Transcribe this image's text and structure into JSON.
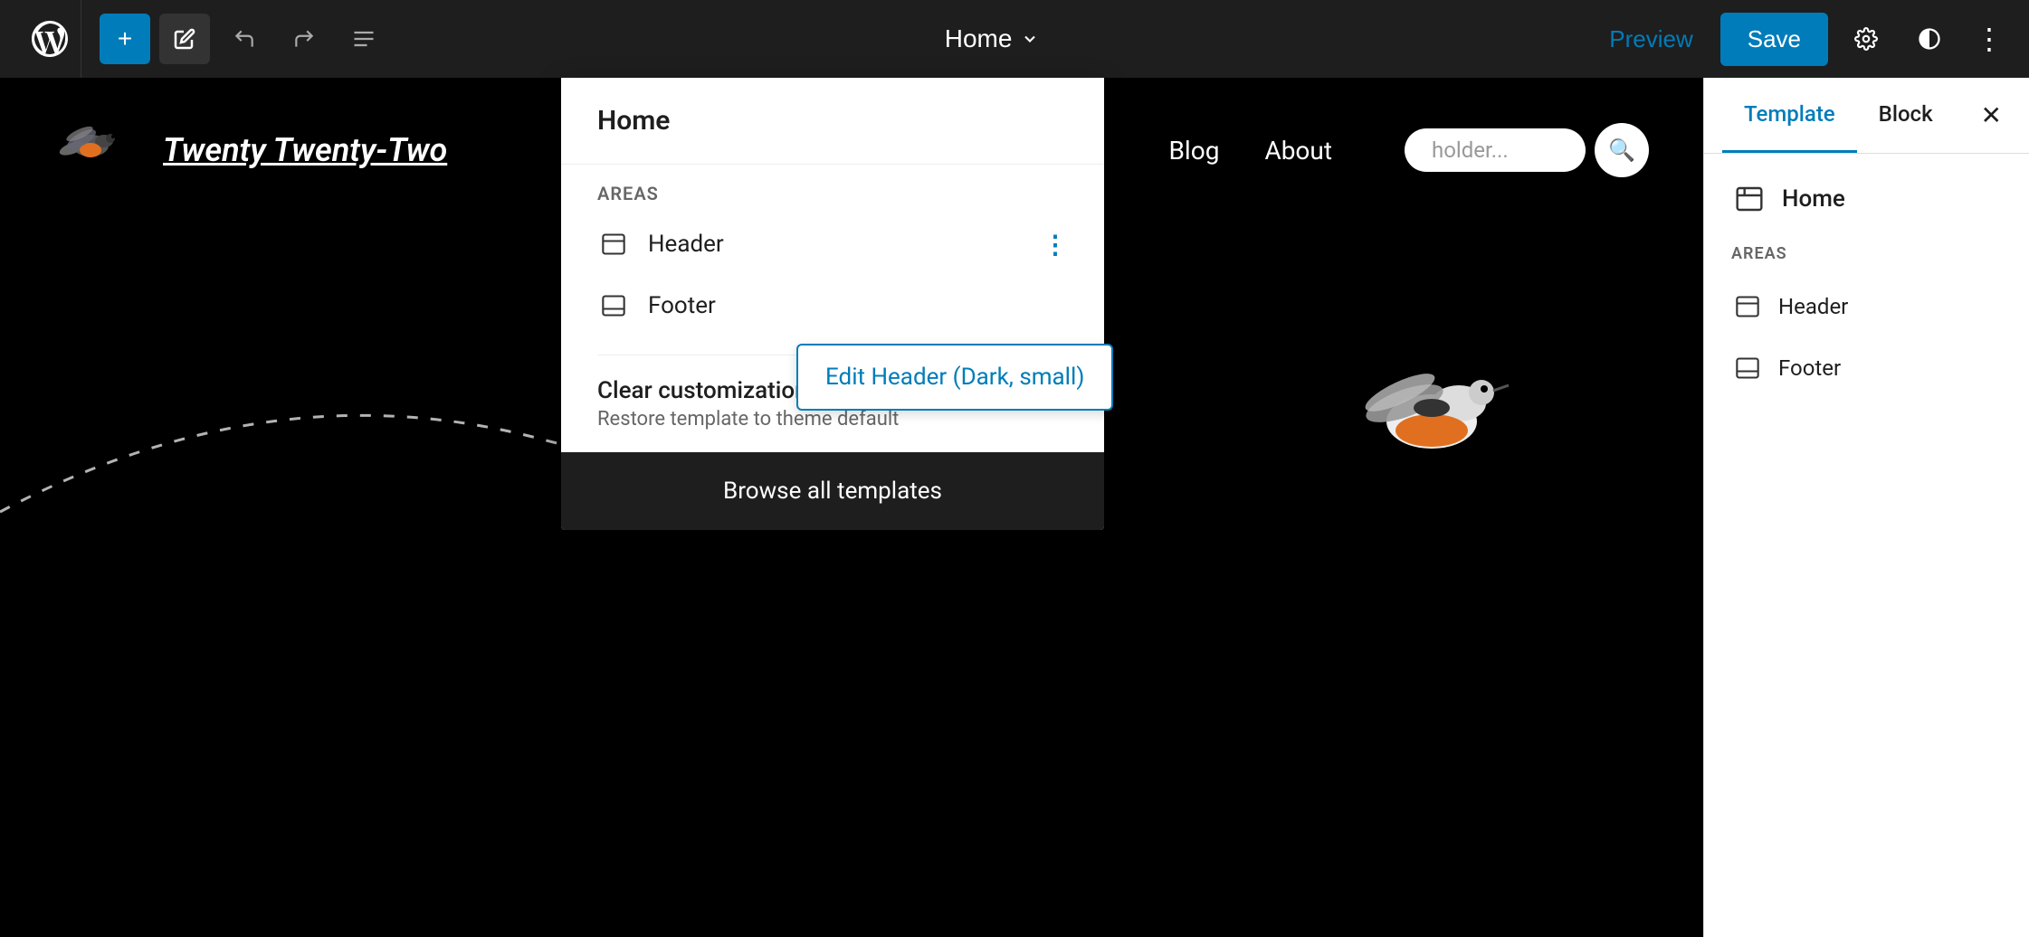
{
  "toolbar": {
    "add_label": "+",
    "page_title": "Home",
    "page_title_chevron": "▾",
    "preview_label": "Preview",
    "save_label": "Save",
    "settings_icon": "⚙",
    "circle_half_icon": "◑",
    "more_icon": "⋮",
    "undo_icon": "↩",
    "redo_icon": "↪",
    "list_icon": "≡"
  },
  "canvas": {
    "site_title": "Twenty Twenty-Two",
    "nav_links": [
      "Blog",
      "About"
    ],
    "search_placeholder": "holder...",
    "dashed_line": true
  },
  "dropdown": {
    "title": "Home",
    "areas_label": "AREAS",
    "header_label": "Header",
    "footer_label": "Footer",
    "clear_title": "Clear customizations",
    "clear_sub": "Restore template to theme default",
    "browse_label": "Browse all templates"
  },
  "edit_popover": {
    "label": "Edit Header (Dark, small)"
  },
  "right_sidebar": {
    "tab_template": "Template",
    "tab_block": "Block",
    "home_label": "Home",
    "areas_label": "AREAS",
    "header_label": "Header",
    "footer_label": "Footer"
  }
}
